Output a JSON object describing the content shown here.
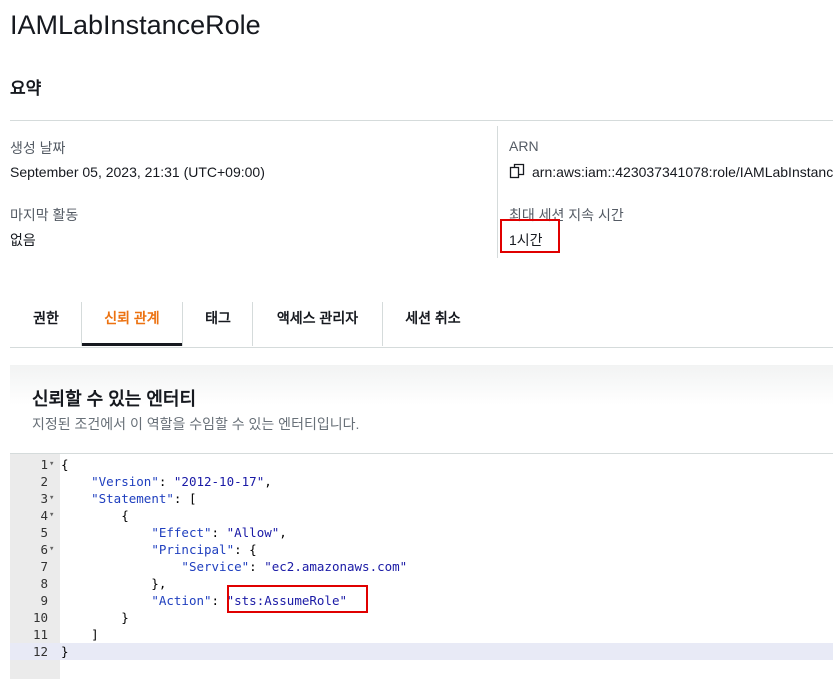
{
  "header": {
    "title": "IAMLabInstanceRole",
    "summary_label": "요약"
  },
  "summary": {
    "created_label": "생성 날짜",
    "created_value": "September 05, 2023, 21:31 (UTC+09:00)",
    "last_activity_label": "마지막 활동",
    "last_activity_value": "없음",
    "arn_label": "ARN",
    "arn_value": "arn:aws:iam::423037341078:role/IAMLabInstanc",
    "max_session_label": "최대 세션 지속 시간",
    "max_session_value": "1시간"
  },
  "tabs": [
    {
      "label": "권한"
    },
    {
      "label": "신뢰 관계"
    },
    {
      "label": "태그"
    },
    {
      "label": "액세스 관리자"
    },
    {
      "label": "세션 취소"
    }
  ],
  "trust_panel": {
    "title": "신뢰할 수 있는 엔터티",
    "description": "지정된 조건에서 이 역할을 수임할 수 있는 엔터티입니다."
  },
  "editor": {
    "lines": [
      {
        "n": "1",
        "t": "{"
      },
      {
        "n": "2",
        "t": "    \"Version\": \"2012-10-17\","
      },
      {
        "n": "3",
        "t": "    \"Statement\": ["
      },
      {
        "n": "4",
        "t": "        {"
      },
      {
        "n": "5",
        "t": "            \"Effect\": \"Allow\","
      },
      {
        "n": "6",
        "t": "            \"Principal\": {"
      },
      {
        "n": "7",
        "t": "                \"Service\": \"ec2.amazonaws.com\""
      },
      {
        "n": "8",
        "t": "            },"
      },
      {
        "n": "9",
        "t": "            \"Action\": \"sts:AssumeRole\""
      },
      {
        "n": "10",
        "t": "        }"
      },
      {
        "n": "11",
        "t": "    ]"
      },
      {
        "n": "12",
        "t": "}"
      }
    ],
    "fold_lines": [
      "1",
      "3",
      "4",
      "6"
    ],
    "active_line": "12"
  },
  "colors": {
    "highlight_box": "#e00000",
    "active_tab": "#ec7211"
  }
}
